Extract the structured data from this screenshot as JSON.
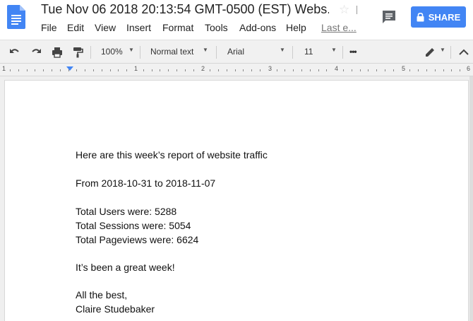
{
  "header": {
    "title": "Tue Nov 06 2018 20:13:54 GMT-0500 (EST) Webs...",
    "menu": [
      "File",
      "Edit",
      "View",
      "Insert",
      "Format",
      "Tools",
      "Add-ons",
      "Help"
    ],
    "last_edit": "Last e...",
    "share_label": "SHARE"
  },
  "toolbar": {
    "zoom": "100%",
    "style": "Normal text",
    "font": "Arial",
    "size": "11",
    "more": "•••"
  },
  "ruler": {
    "numbers": [
      "1",
      "1",
      "2",
      "3",
      "4",
      "5",
      "6"
    ]
  },
  "document": {
    "lines": [
      "Here are this week’s report of website traffic",
      "From 2018-10-31 to 2018-11-07",
      "Total Users were: 5288",
      "Total Sessions were: 5054",
      "Total Pageviews were: 6624",
      "It’s been a great week!",
      "All the best,",
      "Claire Studebaker"
    ]
  },
  "colors": {
    "accent": "#4285f4",
    "toolbar_bg": "#f1f1f1"
  },
  "icons": [
    "docs-logo-icon",
    "star-icon",
    "comment-icon",
    "lock-icon",
    "undo-icon",
    "redo-icon",
    "print-icon",
    "paint-format-icon",
    "pencil-icon",
    "chevron-up-icon"
  ]
}
